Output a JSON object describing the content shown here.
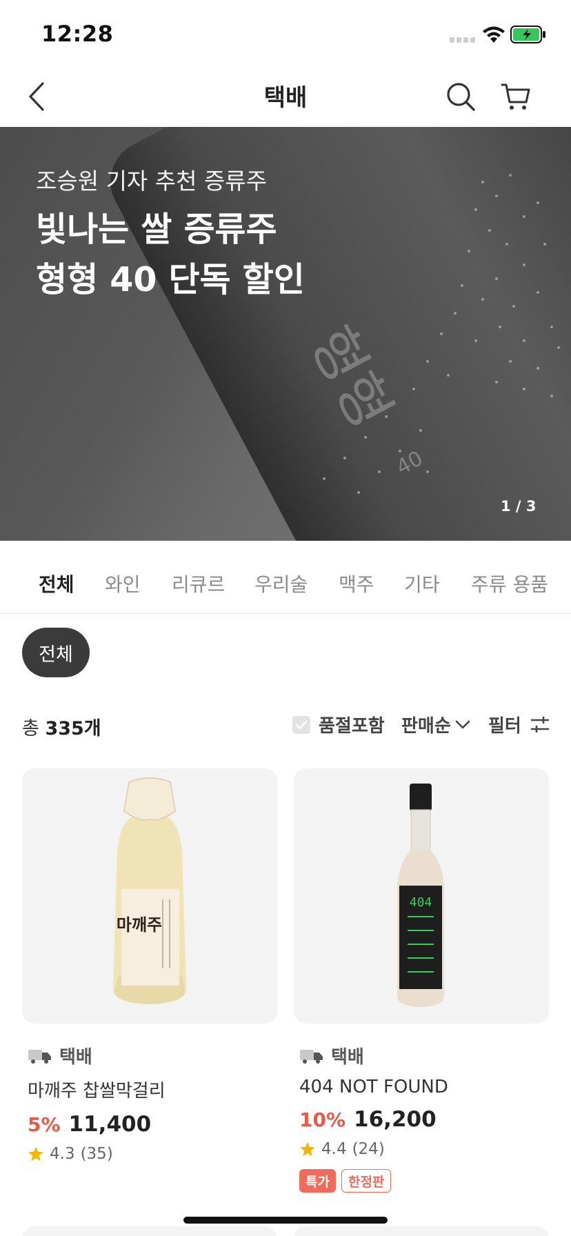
{
  "status_bar": {
    "time": "12:28"
  },
  "header": {
    "title": "택배"
  },
  "banner": {
    "subtitle": "조승원 기자 추천 증류주",
    "title_line1": "빛나는 쌀 증류주",
    "title_line2": "형형 40 단독 할인",
    "bottle_label": "형형",
    "bottle_number": "40",
    "page_indicator": "1 / 3"
  },
  "tabs": [
    {
      "label": "전체",
      "active": true
    },
    {
      "label": "와인",
      "active": false
    },
    {
      "label": "리큐르",
      "active": false
    },
    {
      "label": "우리술",
      "active": false
    },
    {
      "label": "맥주",
      "active": false
    },
    {
      "label": "기타",
      "active": false
    },
    {
      "label": "주류 용품",
      "active": false
    }
  ],
  "chip": {
    "label": "전체"
  },
  "summary": {
    "total_prefix": "총",
    "total_count": "335개",
    "soldout_label": "품절포함",
    "sort_label": "판매순",
    "filter_label": "필터"
  },
  "products": [
    {
      "delivery": "택배",
      "name": "마깨주 찹쌀막걸리",
      "bottle_text": "마깨주",
      "discount": "5%",
      "price": "11,400",
      "rating": "4.3",
      "reviews": "(35)",
      "badges": []
    },
    {
      "delivery": "택배",
      "name": "404 NOT FOUND",
      "bottle_text": "404",
      "discount": "10%",
      "price": "16,200",
      "rating": "4.4",
      "reviews": "(24)",
      "badges": [
        {
          "label": "특가",
          "style": "fill"
        },
        {
          "label": "한정판",
          "style": "outline"
        }
      ]
    }
  ],
  "colors": {
    "discount": "#e65a4a",
    "chip_bg": "#3b3b3b",
    "star": "#f5b800",
    "battery": "#35c759"
  },
  "icons": [
    "back-chevron-icon",
    "search-icon",
    "cart-icon",
    "truck-icon",
    "star-icon",
    "checkbox-icon",
    "chevron-down-icon",
    "filter-icon",
    "wifi-icon",
    "battery-icon"
  ]
}
